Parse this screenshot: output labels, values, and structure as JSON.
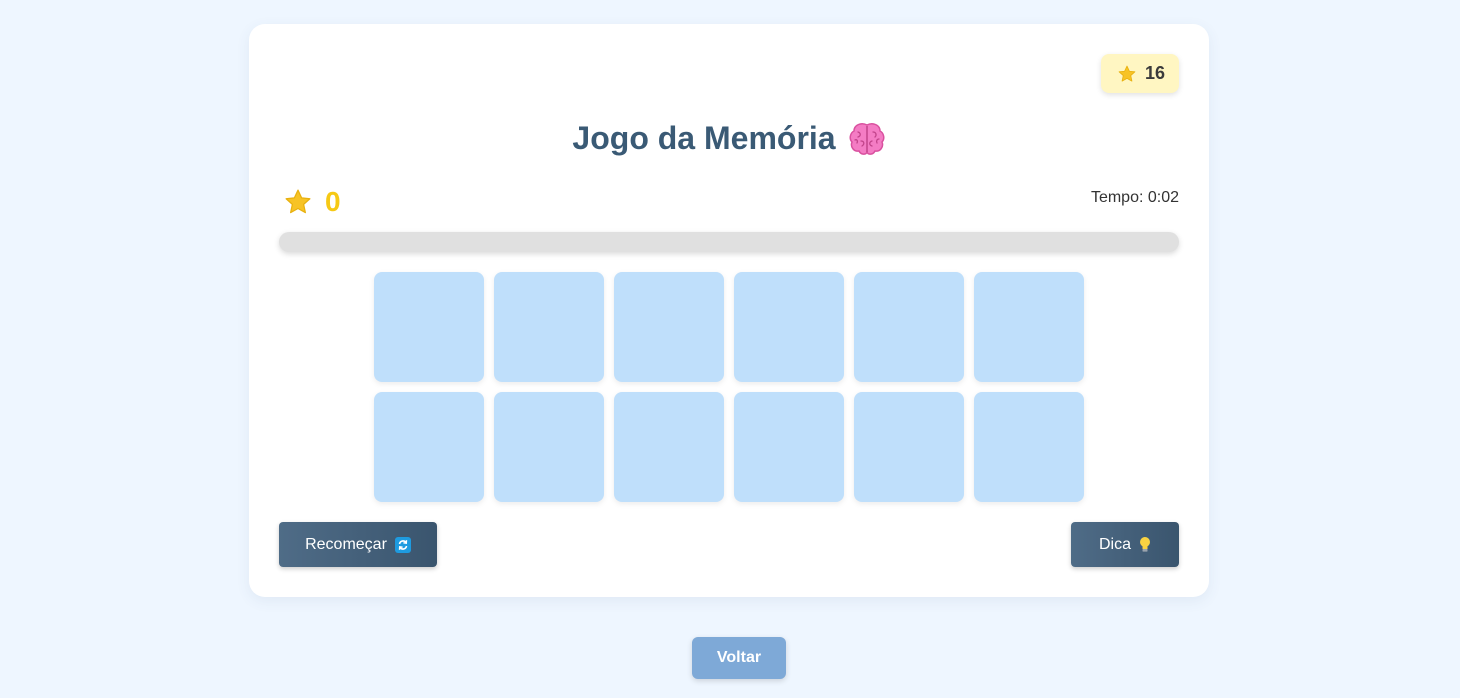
{
  "header": {
    "total_stars": "16",
    "title": "Jogo da Memória"
  },
  "status": {
    "score": "0",
    "timer": "Tempo: 0:02",
    "progress_fraction": 0
  },
  "board": {
    "rows": 2,
    "columns": 6,
    "tile_count": 12
  },
  "controls": {
    "restart_label": "Recomeçar",
    "hint_label": "Dica",
    "back_label": "Voltar"
  },
  "icons": {
    "total_star": "star-icon",
    "title_brain": "brain-icon",
    "score_star": "star-icon",
    "restart": "refresh-icon",
    "hint": "lightbulb-icon"
  },
  "colors": {
    "star": "#f7c325",
    "tile": "#bfdffb",
    "title": "#3a5a75",
    "score": "#f6c915",
    "button": "#44617c",
    "back_button": "#7ea9d7",
    "badge_bg": "#fff6c2"
  }
}
